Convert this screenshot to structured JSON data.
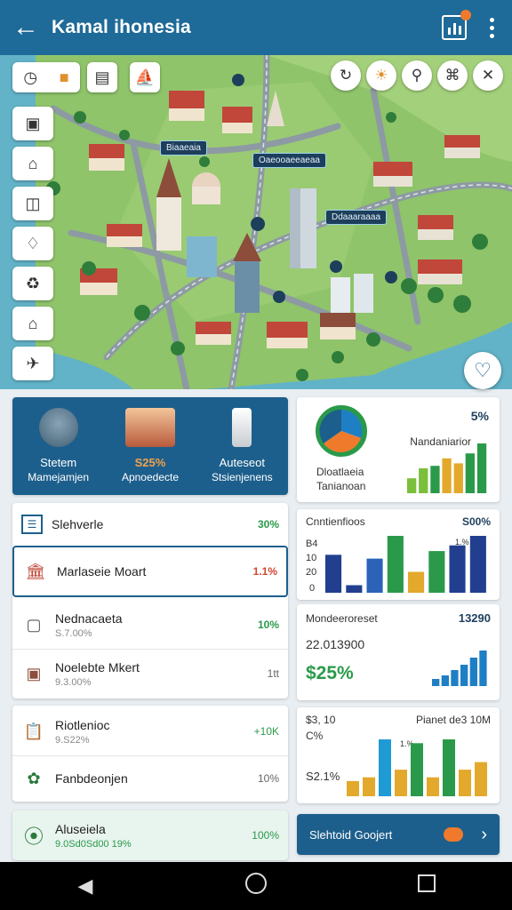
{
  "app": {
    "title": "Kamal ihonesia"
  },
  "map": {
    "labels": [
      "Biaaeaia",
      "Oaeooaeeaeaa",
      "Ddaaaraaaa"
    ],
    "colors": {
      "water": "#62b3c8",
      "land": "#8fc46a",
      "road": "#7b8a94",
      "roof": "#c0473a"
    }
  },
  "hero": {
    "items": [
      {
        "l1": "Stetem",
        "l2": "Mamejamjen",
        "icon": "city-photo-icon"
      },
      {
        "l1": "S25%",
        "l2": "Apnoedecte",
        "icon": "town-photo-icon"
      },
      {
        "l1": "Auteseot",
        "l2": "Stsienjenens",
        "icon": "tower-photo-icon"
      }
    ]
  },
  "list": {
    "rows": [
      {
        "name": "Slehverle",
        "sub": "",
        "value": "30%",
        "color": "#2a9a4a",
        "icon": "list-icon"
      },
      {
        "name": "Marlaseie Moart",
        "sub": "",
        "value": "1.1%",
        "color": "#d0462e",
        "icon": "building-icon"
      },
      {
        "name": "Nednacaeta",
        "sub": "S.7.00%",
        "value": "10%",
        "color": "#2a9a4a",
        "icon": "box-icon"
      },
      {
        "name": "Noelebte Mkert",
        "sub": "9.3.00%",
        "value": "1tt",
        "color": "#666666",
        "icon": "crate-icon"
      }
    ]
  },
  "list2": {
    "rows": [
      {
        "name": "Riotlenioc",
        "sub": "9.S22%",
        "value": "+10K",
        "color": "#2a9a4a",
        "icon": "clipboard-icon"
      },
      {
        "name": "Fanbdeonjen",
        "sub": "",
        "value": "10%",
        "color": "#666666",
        "icon": "leaf-icon"
      }
    ]
  },
  "list3": {
    "name": "Aluseiela",
    "sub": "9.0Sd0Sd00 19%",
    "value": "100%",
    "color": "#2a9a4a",
    "icon": "pin-icon"
  },
  "panel1": {
    "percent": "5%",
    "subtitle": "Nandaniarior",
    "label1": "Dloatlaeia",
    "label2": "Tanianoan"
  },
  "panel2": {
    "title": "Cnntienfioos",
    "value": "S00%",
    "axis": [
      "B4",
      "10",
      "20",
      "0"
    ],
    "annot": "1.%"
  },
  "panel3": {
    "title": "Mondeeroreset",
    "value": "13290",
    "line": "22.013900",
    "big": "$25%"
  },
  "panel4": {
    "left": "$3, 10",
    "left2": "C%",
    "right": "Pianet de3 10M",
    "bottom": "S2.1%",
    "annot": "1.%"
  },
  "button": {
    "label": "Slehtoid Goojert"
  },
  "chart_data": [
    {
      "type": "bar",
      "title": "Nandaniarior",
      "values": [
        6,
        10,
        11,
        14,
        12,
        16,
        20
      ],
      "colors": [
        "#7bbf3a",
        "#7bbf3a",
        "#2a9a4a",
        "#e2a92c",
        "#e2a92c",
        "#2a9a4a",
        "#2a9a4a"
      ],
      "ylim": [
        0,
        20
      ]
    },
    {
      "type": "bar",
      "title": "Cnntienfioos",
      "values": [
        40,
        8,
        36,
        60,
        22,
        44,
        50,
        60
      ],
      "colors": [
        "#223f8f",
        "#223f8f",
        "#2a63b8",
        "#2a9a4a",
        "#e2a92c",
        "#2a9a4a",
        "#223f8f",
        "#223f8f"
      ],
      "ylim": [
        0,
        60
      ]
    },
    {
      "type": "bar",
      "title": "Mondeeroreset",
      "values": [
        4,
        6,
        9,
        12,
        16,
        20
      ],
      "colors": [
        "#1e7fc4",
        "#1e7fc4",
        "#1e7fc4",
        "#1e7fc4",
        "#1e7fc4",
        "#1e7fc4"
      ],
      "ylim": [
        0,
        20
      ]
    },
    {
      "type": "bar",
      "title": "Pianet de3 10M",
      "values": [
        8,
        10,
        30,
        14,
        28,
        10,
        30,
        14,
        18
      ],
      "colors": [
        "#e2a92c",
        "#e2a92c",
        "#1e9bd4",
        "#e2a92c",
        "#2a9a4a",
        "#e2a92c",
        "#2a9a4a",
        "#e2a92c",
        "#e2a92c"
      ],
      "ylim": [
        0,
        30
      ]
    }
  ]
}
